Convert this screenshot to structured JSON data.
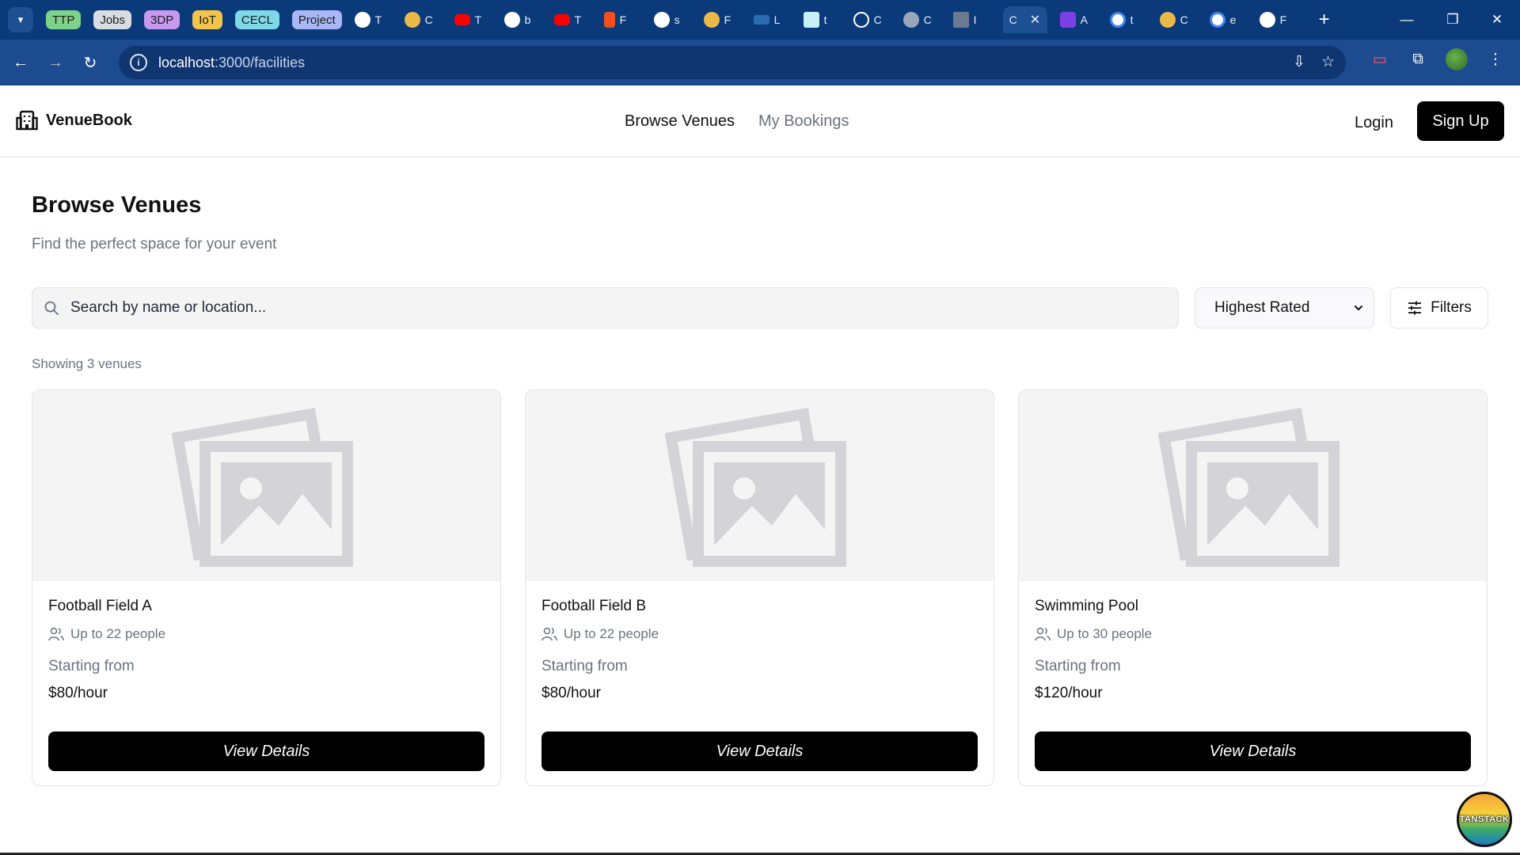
{
  "browser": {
    "tab_groups": [
      "TTP",
      "Jobs",
      "3DP",
      "IoT",
      "CECL",
      "Project"
    ],
    "tabs": [
      {
        "icon": "github-icon",
        "letter": "T"
      },
      {
        "icon": "chrome-icon",
        "letter": "C"
      },
      {
        "icon": "youtube-icon",
        "letter": "T"
      },
      {
        "icon": "github-icon",
        "letter": "b"
      },
      {
        "icon": "youtube-icon",
        "letter": "T"
      },
      {
        "icon": "figma-icon",
        "letter": "F"
      },
      {
        "icon": "github-icon",
        "letter": "s"
      },
      {
        "icon": "chrome-icon",
        "letter": "F"
      },
      {
        "icon": "gorm-icon",
        "letter": "L"
      },
      {
        "icon": "docs-icon",
        "letter": "t"
      },
      {
        "icon": "openai-icon",
        "letter": "C"
      },
      {
        "icon": "globe-icon",
        "letter": "C"
      },
      {
        "icon": "app-icon",
        "letter": "I"
      },
      {
        "icon": "page-icon",
        "letter": "C"
      },
      {
        "icon": "app-icon",
        "letter": "A"
      },
      {
        "icon": "google-icon",
        "letter": "t"
      },
      {
        "icon": "chrome-icon",
        "letter": "C"
      },
      {
        "icon": "google-icon",
        "letter": "e"
      },
      {
        "icon": "github-icon",
        "letter": "F"
      }
    ],
    "url_host": "localhost",
    "url_path": ":3000/facilities"
  },
  "app": {
    "brand": "VenueBook",
    "nav": {
      "browse": "Browse Venues",
      "bookings": "My Bookings"
    },
    "login": "Login",
    "signup": "Sign Up"
  },
  "main": {
    "title": "Browse Venues",
    "subtitle": "Find the perfect space for your event",
    "search_placeholder": "Search by name or location...",
    "sort_selected": "Highest Rated",
    "filters_label": "Filters",
    "count_text": "Showing 3 venues"
  },
  "venues": [
    {
      "name": "Football Field A",
      "capacity": "Up to 22 people",
      "from_label": "Starting from",
      "price": "$80/hour",
      "button": "View Details"
    },
    {
      "name": "Football Field B",
      "capacity": "Up to 22 people",
      "from_label": "Starting from",
      "price": "$80/hour",
      "button": "View Details"
    },
    {
      "name": "Swimming Pool",
      "capacity": "Up to 30 people",
      "from_label": "Starting from",
      "price": "$120/hour",
      "button": "View Details"
    }
  ],
  "devtools_badge": "TANSTACK"
}
